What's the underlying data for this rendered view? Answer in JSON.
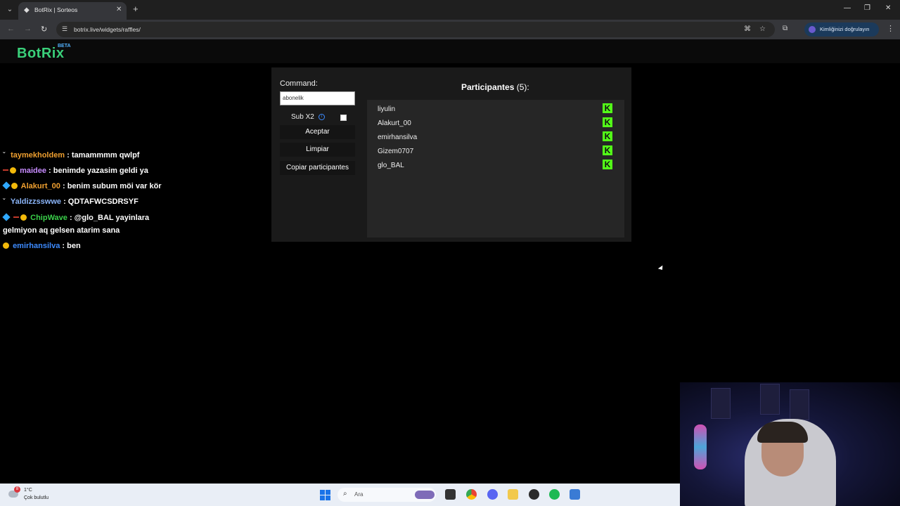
{
  "browser": {
    "tab_title": "BotRix | Sorteos",
    "tab_close": "✕",
    "new_tab": "+",
    "url": "botrix.live/widgets/raffles/",
    "profile_label": "Kimliğinizi doğrulayın"
  },
  "app": {
    "logo": "BotRix",
    "logo_badge": "BETA"
  },
  "chat": {
    "messages": [
      {
        "user": "taymekholdem",
        "text": ": tamammmm qwlpf",
        "color": "#f0a030"
      },
      {
        "user": "maidee",
        "text": ": benimde yazasim geldi ya",
        "color": "#c88cff"
      },
      {
        "user": "Alakurt_00",
        "text": ": benim subum möi var kör",
        "color": "#f0a030"
      },
      {
        "user": "Yaldizzsswwe",
        "text": ": QDTAFWCSDRSYF",
        "color": "#8ab4f8"
      },
      {
        "user": "ChipWave",
        "text": ": @glo_BAL yayinlara",
        "text2": "gelmiyon aq gelsen atarim sana",
        "color": "#3ad04a"
      },
      {
        "user": "emirhansilva",
        "text": ": ben",
        "color": "#3d8bff"
      }
    ]
  },
  "raffle": {
    "command_label": "Command:",
    "command_value": "abonelik",
    "sub_label": "Sub X2",
    "sub_checked": false,
    "accept_label": "Aceptar",
    "clear_label": "Limpiar",
    "copy_label": "Copiar participantes",
    "participants_title": "Participantes",
    "participants_count": "(5):",
    "participants": [
      {
        "name": "liyulin"
      },
      {
        "name": "Alakurt_00"
      },
      {
        "name": "emirhansilva"
      },
      {
        "name": "Gizem0707"
      },
      {
        "name": "glo_BAL"
      }
    ],
    "platform_icon_letter": "K",
    "platform_color": "#53fc18"
  },
  "taskbar": {
    "weather_badge": "8",
    "weather_temp": "1°C",
    "weather_desc": "Çok bulutlu",
    "search_placeholder": "Ara"
  }
}
